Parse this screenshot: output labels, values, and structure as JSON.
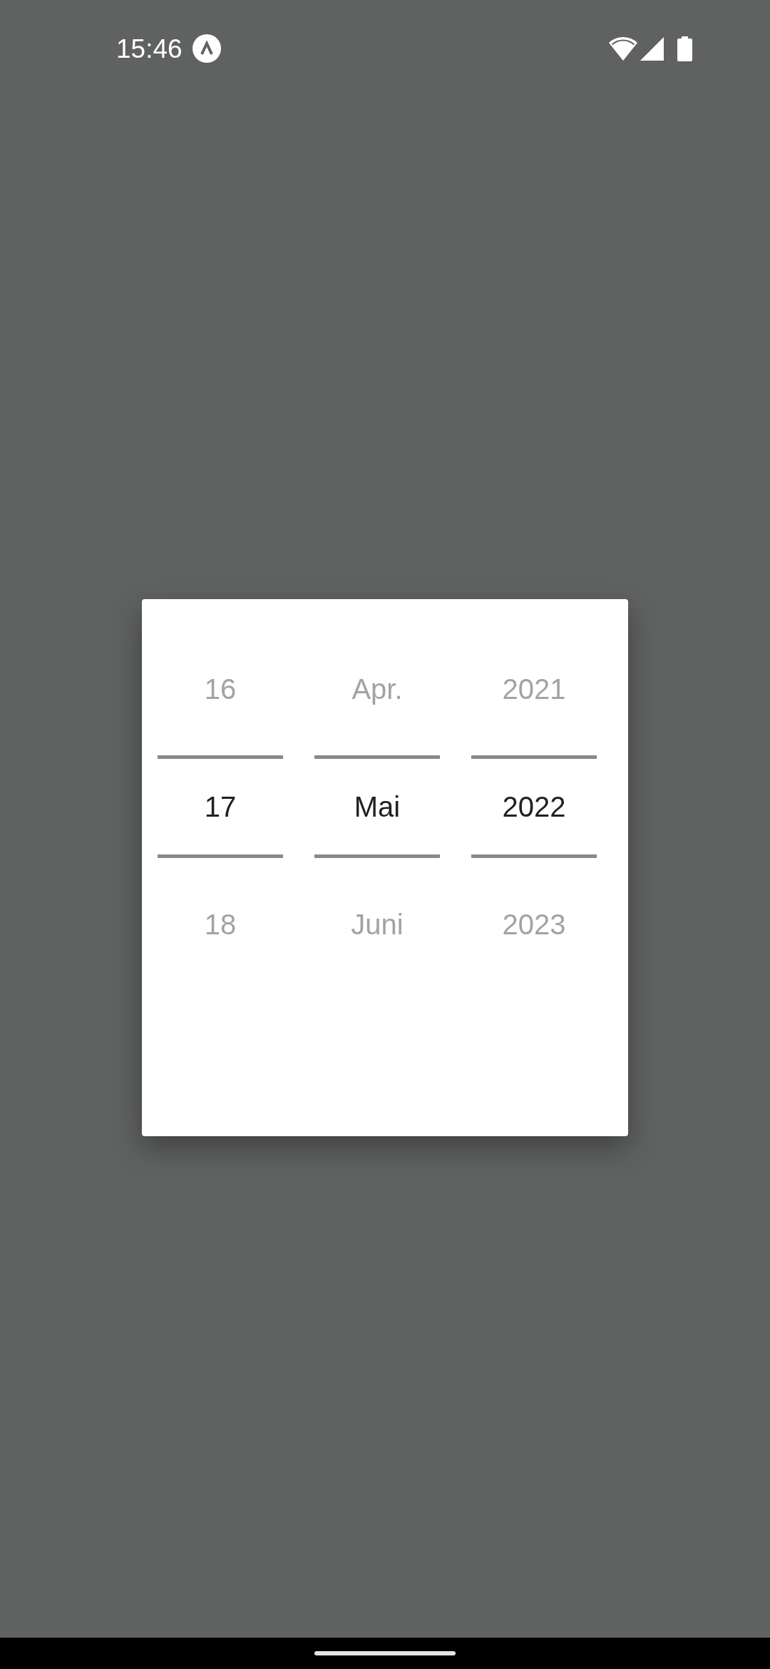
{
  "status_bar": {
    "time": "15:46"
  },
  "date_picker": {
    "columns": [
      {
        "items": [
          {
            "label": "16",
            "selected": false
          },
          {
            "label": "17",
            "selected": true
          },
          {
            "label": "18",
            "selected": false
          }
        ]
      },
      {
        "items": [
          {
            "label": "Apr.",
            "selected": false
          },
          {
            "label": "Mai",
            "selected": true
          },
          {
            "label": "Juni",
            "selected": false
          }
        ]
      },
      {
        "items": [
          {
            "label": "2021",
            "selected": false
          },
          {
            "label": "2022",
            "selected": true
          },
          {
            "label": "2023",
            "selected": false
          }
        ]
      }
    ]
  }
}
